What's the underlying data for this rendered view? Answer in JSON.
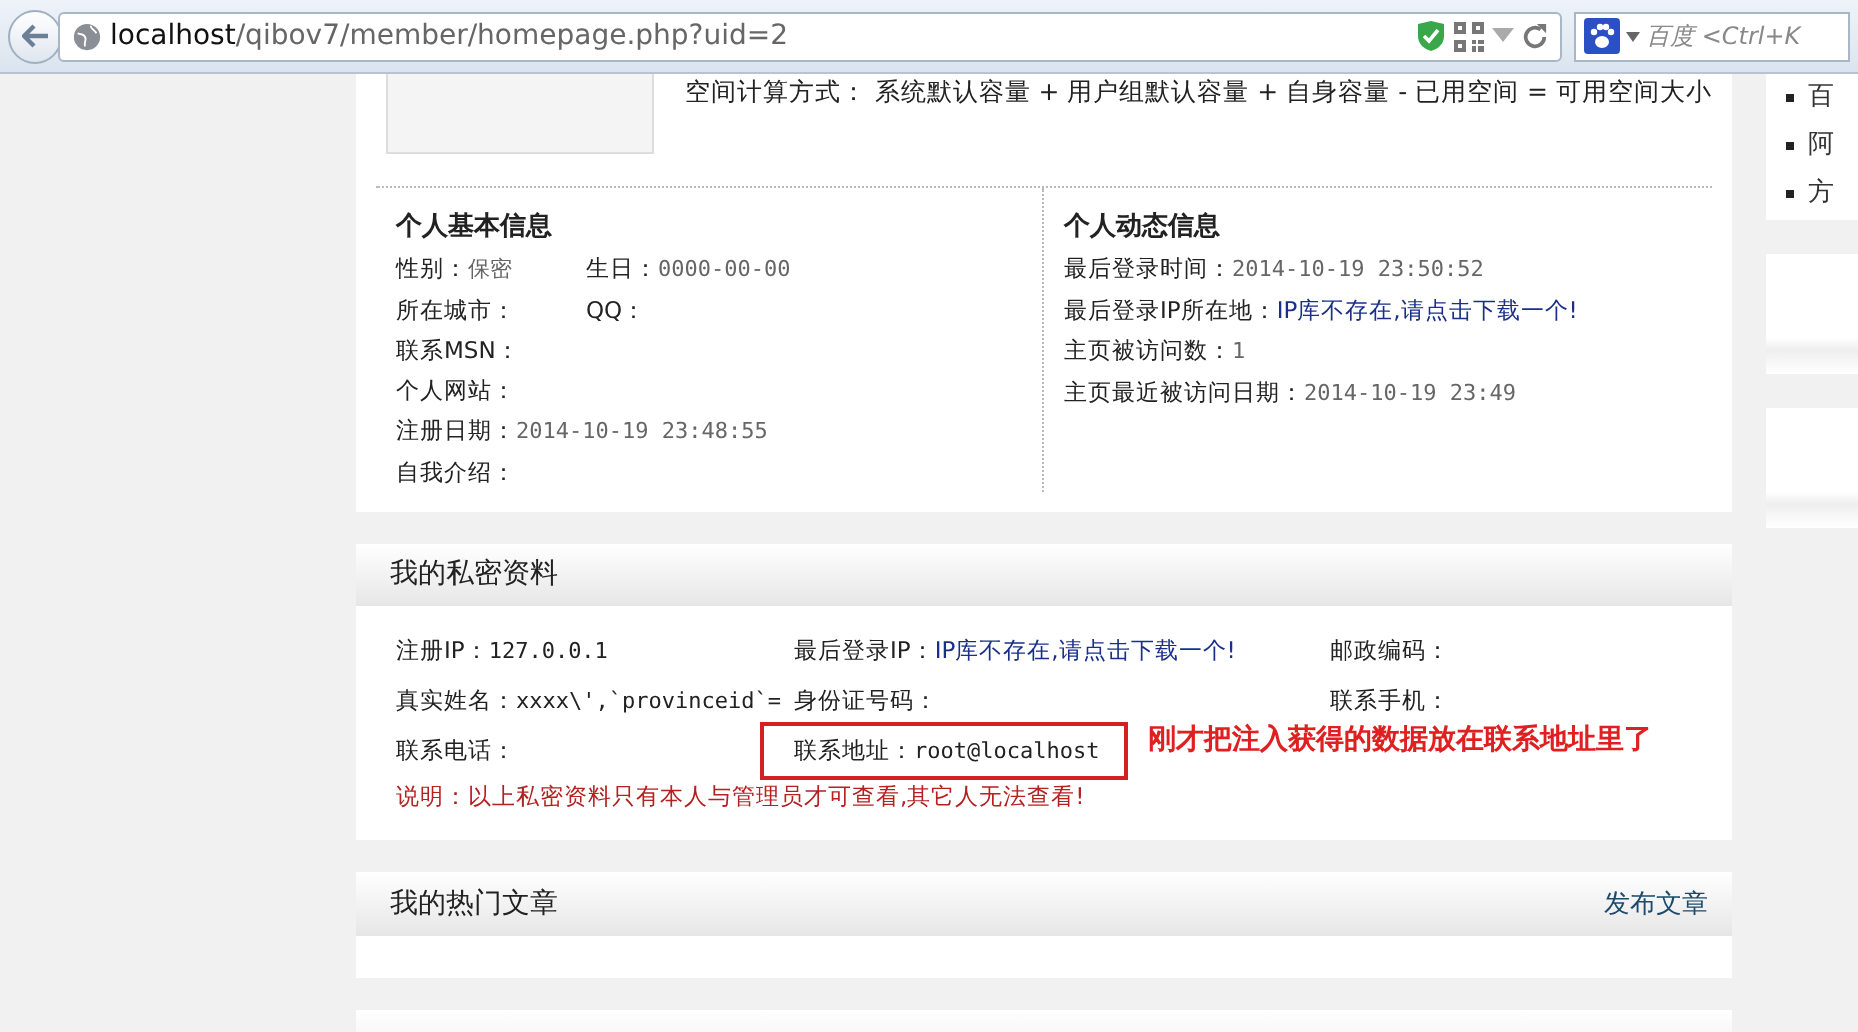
{
  "browser": {
    "url_host": "localhost",
    "url_path": "/qibov7/member/homepage.php?uid=2",
    "search_placeholder": "百度 <Ctrl+K"
  },
  "profile": {
    "space_formula": "空间计算方式： 系统默认容量 + 用户组默认容量 + 自身容量 - 已用空间 = 可用空间大小",
    "basic_info": {
      "title": "个人基本信息",
      "rows": [
        [
          {
            "label": "性别：",
            "value": "保密",
            "kind": "muted"
          },
          {
            "label": "生日：",
            "value": "0000-00-00",
            "kind": "muted"
          }
        ],
        [
          {
            "label": "所在城市："
          },
          {
            "label": "QQ："
          }
        ],
        [
          {
            "label": "联系MSN："
          }
        ],
        [
          {
            "label": "个人网站："
          }
        ],
        [
          {
            "label": "注册日期：",
            "value": "2014-10-19 23:48:55",
            "kind": "muted"
          }
        ],
        [
          {
            "label": "自我介绍："
          }
        ]
      ]
    },
    "dynamic_info": {
      "title": "个人动态信息",
      "rows": [
        {
          "label": "最后登录时间：",
          "value": "2014-10-19 23:50:52",
          "kind": "muted"
        },
        {
          "label": "最后登录IP所在地：",
          "value": "IP库不存在,请点击下载一个!",
          "kind": "link"
        },
        {
          "label": "主页被访问数：",
          "value": "1",
          "kind": "muted"
        },
        {
          "label": "主页最近被访问日期：",
          "value": "2014-10-19 23:49",
          "kind": "muted"
        }
      ]
    }
  },
  "private_info": {
    "title": "我的私密资料",
    "cells": [
      {
        "label": "注册IP：",
        "value": "127.0.0.1",
        "kind": "text",
        "highlighted": false
      },
      {
        "label": "最后登录IP：",
        "value": "IP库不存在,请点击下载一个!",
        "kind": "link",
        "highlighted": false
      },
      {
        "label": "邮政编码：",
        "highlighted": false
      },
      {
        "label": "真实姓名：",
        "value": "xxxx\\',`provinceid`=",
        "kind": "text",
        "highlighted": false
      },
      {
        "label": "身份证号码：",
        "highlighted": false
      },
      {
        "label": "联系手机：",
        "highlighted": false
      },
      {
        "label": "联系电话：",
        "highlighted": false
      },
      {
        "label": "联系地址：",
        "value": "root@localhost",
        "kind": "text",
        "highlighted": true
      }
    ],
    "annotation": "刚才把注入获得的数据放在联系地址里了",
    "note": "说明：以上私密资料只有本人与管理员才可查看,其它人无法查看!"
  },
  "hot_articles": {
    "title": "我的热门文章",
    "action": "发布文章"
  },
  "sidebar": {
    "items": [
      "百",
      "阿",
      "方"
    ]
  }
}
